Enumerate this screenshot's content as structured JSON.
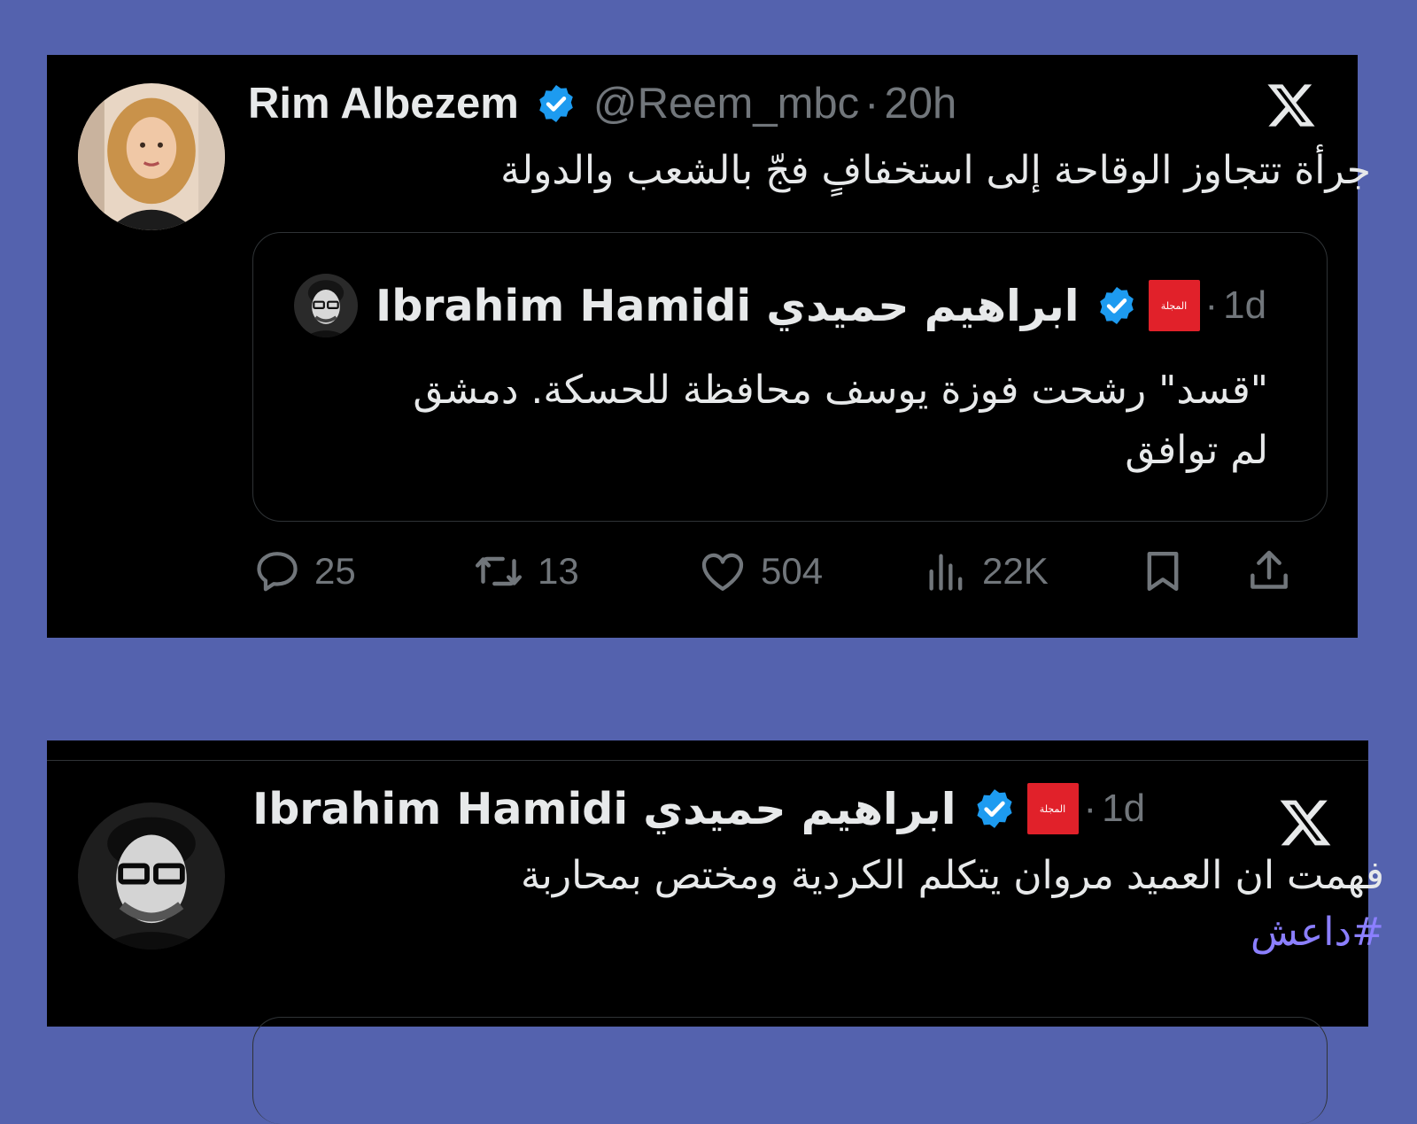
{
  "tweet1": {
    "author_name": "Rim Albezem",
    "handle": "@Reem_mbc",
    "separator": "·",
    "time": "20h",
    "text": "جرأة تتجاوز الوقاحة إلى استخفافٍ فجّ بالشعب والدولة",
    "quoted": {
      "author_name": "Ibrahim Hamidi ابراهيم حميدي",
      "org_badge": "المجلة",
      "separator": "·",
      "time": "1d",
      "text_line1": "\"قسد\" رشحت فوزة يوسف محافظة للحسكة. دمشق",
      "text_line2": "لم توافق"
    },
    "actions": {
      "replies": "25",
      "reposts": "13",
      "likes": "504",
      "views": "22K"
    },
    "icons": [
      "verified-icon",
      "x-logo-icon",
      "reply-icon",
      "repost-icon",
      "like-icon",
      "views-icon",
      "bookmark-icon",
      "share-icon"
    ]
  },
  "tweet2": {
    "author_name": "Ibrahim Hamidi ابراهيم حميدي",
    "org_badge": "المجلة",
    "separator": "·",
    "time": "1d",
    "text": "فهمت ان العميد مروان يتكلم الكردية ومختص بمحاربة",
    "hashtag": "#داعش"
  },
  "colors": {
    "background": "#5462ae",
    "card": "#000000",
    "verified": "#1d9bf0",
    "secondary_text": "#71767b",
    "hashtag": "#8b7fff",
    "org_badge": "#e1212a"
  }
}
